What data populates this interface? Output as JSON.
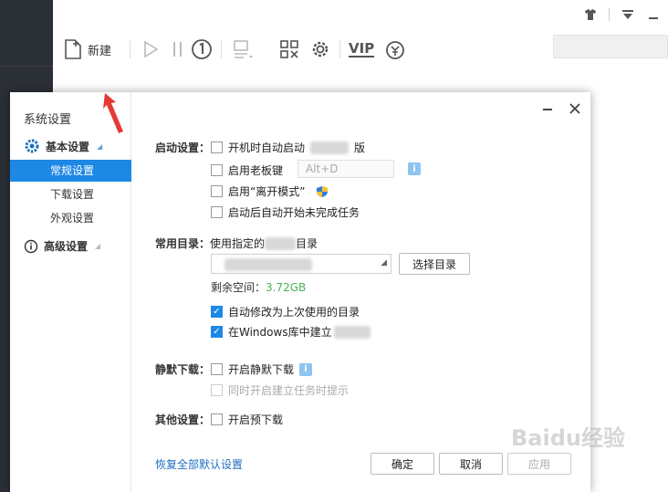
{
  "app": {
    "toolbar": {
      "new_label": "新建",
      "vip_label": "VIP"
    }
  },
  "dialog": {
    "title": "系统设置",
    "sidebar": {
      "group_basic": "基本设置",
      "items": [
        "常规设置",
        "下载设置",
        "外观设置"
      ],
      "group_advanced": "高级设置"
    },
    "startup": {
      "label": "启动设置：",
      "opt1": "开机时自动启动",
      "opt1_tail": "版",
      "opt2": "启用老板键",
      "hotkey_placeholder": "Alt+D",
      "opt3": "启用“离开模式”",
      "opt4": "启动后自动开始未完成任务"
    },
    "directory": {
      "label": "常用目录：",
      "text_a": "使用指定的",
      "text_b": "目录",
      "select_button": "选择目录",
      "space_label": "剩余空间：",
      "space_value": "3.72GB",
      "opt_auto": "自动修改为上次使用的目录",
      "opt_lib": "在Windows库中建立"
    },
    "silent": {
      "label": "静默下载：",
      "opt1": "开启静默下载",
      "opt2": "同时开启建立任务时提示"
    },
    "other": {
      "label": "其他设置：",
      "opt1": "开启预下载"
    },
    "footer": {
      "restore": "恢复全部默认设置",
      "ok": "确定",
      "cancel": "取消",
      "apply": "应用"
    }
  },
  "watermark": "Baidu经验",
  "colors": {
    "accent": "#1e88e5",
    "space_value": "#4caf50",
    "link": "#1e6fc2",
    "annotation": "#e53935"
  }
}
